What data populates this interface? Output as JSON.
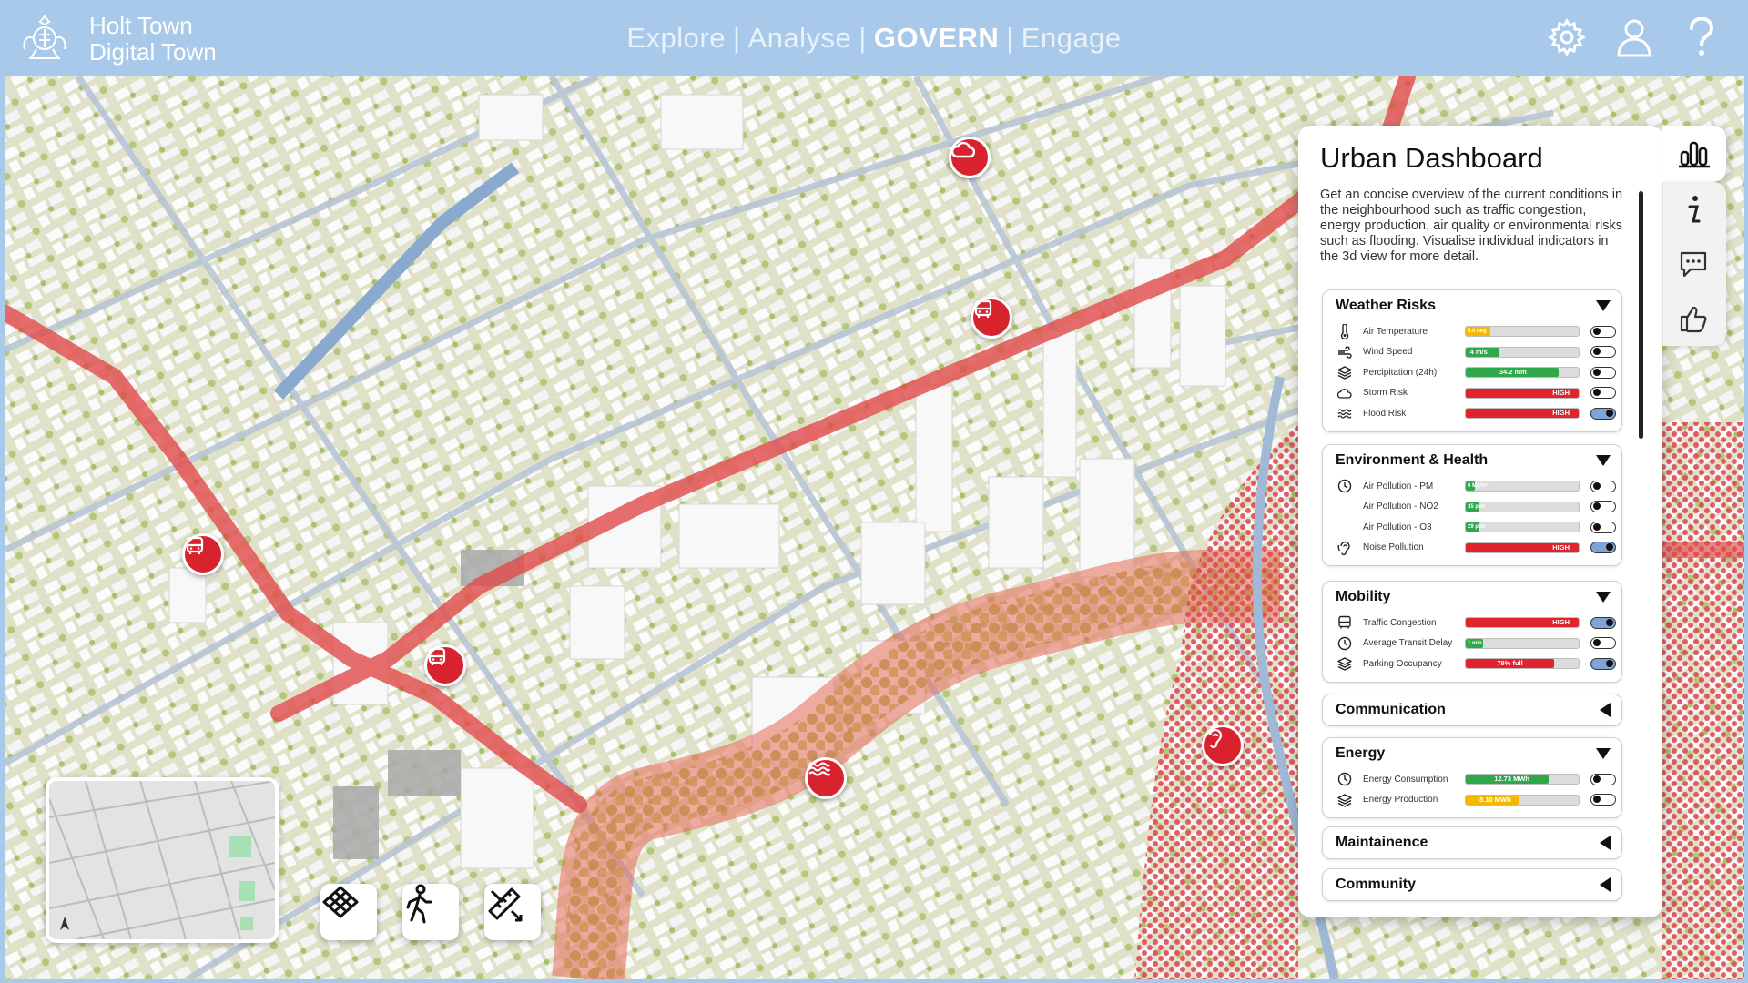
{
  "app": {
    "brand_line1": "Holt Town",
    "brand_line2": "Digital Town",
    "nav": [
      "Explore",
      "Analyse",
      "GOVERN",
      "Engage"
    ],
    "nav_active": "GOVERN",
    "nav_separator": "|",
    "header_icons": [
      "gear-icon",
      "user-icon",
      "help-icon"
    ]
  },
  "colors": {
    "header_bg": "#a9c9ea",
    "pin_red": "#d8232f",
    "bar_green": "#2ea84a",
    "bar_yellow": "#f4b800",
    "bar_red": "#e0232c",
    "toggle_on": "#7ea4d8"
  },
  "dashboard": {
    "title": "Urban Dashboard",
    "description": "Get an concise overview of the current conditions in the neighbourhood such as traffic congestion, energy production, air quality or environmental risks such as flooding. Visualise individual indicators in the 3d view for more detail.",
    "side_tabs": [
      "bar-chart-icon",
      "info-icon",
      "comment-icon",
      "thumbs-up-icon"
    ],
    "sections": [
      {
        "title": "Weather Risks",
        "expanded": true,
        "rows": [
          {
            "label": "Air Temperature",
            "icon": "thermometer-icon",
            "value": "5.0 deg",
            "level": 0.22,
            "color": "#f4b800",
            "on": false
          },
          {
            "label": "Wind Speed",
            "icon": "wind-icon",
            "value": "4 m/s",
            "level": 0.3,
            "color": "#2ea84a",
            "on": false
          },
          {
            "label": "Percipitation (24h)",
            "icon": "layers-icon",
            "value": "34.2 mm",
            "level": 0.82,
            "color": "#2ea84a",
            "on": false
          },
          {
            "label": "Storm Risk",
            "icon": "cloud-icon",
            "value": "HIGH",
            "level": 1.0,
            "color": "#e0232c",
            "on": false
          },
          {
            "label": "Flood Risk",
            "icon": "waves-icon",
            "value": "HIGH",
            "level": 1.0,
            "color": "#e0232c",
            "on": true
          }
        ]
      },
      {
        "title": "Environment & Health",
        "expanded": true,
        "rows": [
          {
            "label": "Air Pollution - PM",
            "icon": "clock-icon",
            "value": "6 Mg/m³",
            "level": 0.08,
            "color": "#2ea84a",
            "on": false
          },
          {
            "label": "Air Pollution - NO2",
            "icon": "",
            "value": "35 ppb",
            "level": 0.12,
            "color": "#2ea84a",
            "on": false
          },
          {
            "label": "Air Pollution - O3",
            "icon": "",
            "value": "29 ppb",
            "level": 0.12,
            "color": "#2ea84a",
            "on": false
          },
          {
            "label": "Noise Pollution",
            "icon": "ear-icon",
            "value": "HIGH",
            "level": 1.0,
            "color": "#e0232c",
            "on": true
          }
        ]
      },
      {
        "title": "Mobility",
        "expanded": true,
        "rows": [
          {
            "label": "Traffic Congestion",
            "icon": "bus-icon",
            "value": "HIGH",
            "level": 1.0,
            "color": "#e0232c",
            "on": true
          },
          {
            "label": "Average Transit Delay",
            "icon": "clock-icon",
            "value": "1 min",
            "level": 0.15,
            "color": "#2ea84a",
            "on": false
          },
          {
            "label": "Parking Occupancy",
            "icon": "layers-icon",
            "value": "78% full",
            "level": 0.78,
            "color": "#e0232c",
            "on": true
          }
        ]
      },
      {
        "title": "Communication",
        "expanded": false,
        "rows": []
      },
      {
        "title": "Energy",
        "expanded": true,
        "rows": [
          {
            "label": "Energy Consumption",
            "icon": "clock-icon",
            "value": "12.73 MWh",
            "level": 0.73,
            "color": "#2ea84a",
            "on": false
          },
          {
            "label": "Energy Production",
            "icon": "layers-icon",
            "value": "8.10 MWh",
            "level": 0.47,
            "color": "#f4b800",
            "on": false
          }
        ]
      },
      {
        "title": "Maintainence",
        "expanded": false,
        "rows": []
      },
      {
        "title": "Community",
        "expanded": false,
        "rows": []
      }
    ]
  },
  "map": {
    "pins": [
      "cloud-icon",
      "bus-icon",
      "bus-icon",
      "bus-icon",
      "waves-icon",
      "ear-icon"
    ],
    "tools": [
      "grid-icon",
      "walk-icon",
      "measure-icon"
    ],
    "minimap_icon": "compass-icon"
  }
}
